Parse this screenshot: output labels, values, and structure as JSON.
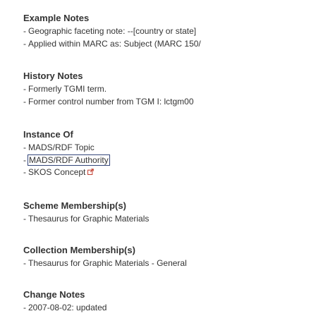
{
  "example_notes": {
    "heading": "Example Notes",
    "items": [
      "Geographic faceting note: --[country or state]",
      "Applied within MARC as: Subject (MARC 150/"
    ]
  },
  "history_notes": {
    "heading": "History Notes",
    "items": [
      "Formerly TGMI term.",
      "Former control number from TGM I: lctgm00"
    ]
  },
  "instance_of": {
    "heading": "Instance Of",
    "items": [
      "MADS/RDF Topic",
      "MADS/RDF Authority",
      "SKOS Concept"
    ],
    "external_link_icon": "external-link-icon"
  },
  "scheme_membership": {
    "heading": "Scheme Membership(s)",
    "items": [
      "Thesaurus for Graphic Materials"
    ]
  },
  "collection_membership": {
    "heading": "Collection Membership(s)",
    "items": [
      "Thesaurus for Graphic Materials - General"
    ]
  },
  "change_notes": {
    "heading": "Change Notes",
    "items": [
      "2007-08-02: updated"
    ]
  },
  "dash": "-",
  "colors": {
    "text": "#333333",
    "focus_outline": "#33457a",
    "icon": "#c0392b"
  }
}
